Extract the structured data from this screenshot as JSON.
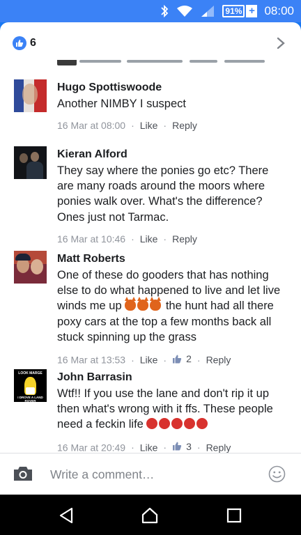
{
  "status_bar": {
    "battery_percent": "91%",
    "time": "08:00",
    "icons": [
      "bluetooth-icon",
      "wifi-icon",
      "signal-icon",
      "battery-charging-icon"
    ]
  },
  "likes_header": {
    "count": "6",
    "icon": "like-thumb-icon",
    "accent_color": "#3b82f6"
  },
  "comments": [
    {
      "name": "Hugo Spottiswoode",
      "text": "Another NIMBY I suspect",
      "timestamp": "16 Mar at 08:00",
      "like_label": "Like",
      "reply_label": "Reply"
    },
    {
      "name": "Kieran Alford",
      "text": "They say where the ponies go etc? There are many roads around the moors where ponies walk over. What's the difference? Ones just not Tarmac.",
      "timestamp": "16 Mar at 10:46",
      "like_label": "Like",
      "reply_label": "Reply"
    },
    {
      "name": "Matt Roberts",
      "text_before": "One of these do gooders that has nothing else to do what happened to live and let live winds me up",
      "text_after": "the hunt had all there poxy cars at the top a few months back all stuck spinning up the grass",
      "timestamp": "16 Mar at 13:53",
      "like_label": "Like",
      "reactions": "2",
      "reply_label": "Reply"
    },
    {
      "name": "John Barrasin",
      "text": "Wtf!! If you use the lane and don't rip it up then what's wrong with it ffs. These people need a feckin life",
      "timestamp": "16 Mar at 20:49",
      "like_label": "Like",
      "reactions": "3",
      "reply_label": "Reply",
      "avatar_text_top": "LOOK MARGE",
      "avatar_text_bottom": "I DROVE A LAND ROVER"
    }
  ],
  "composer": {
    "placeholder": "Write a comment…"
  }
}
